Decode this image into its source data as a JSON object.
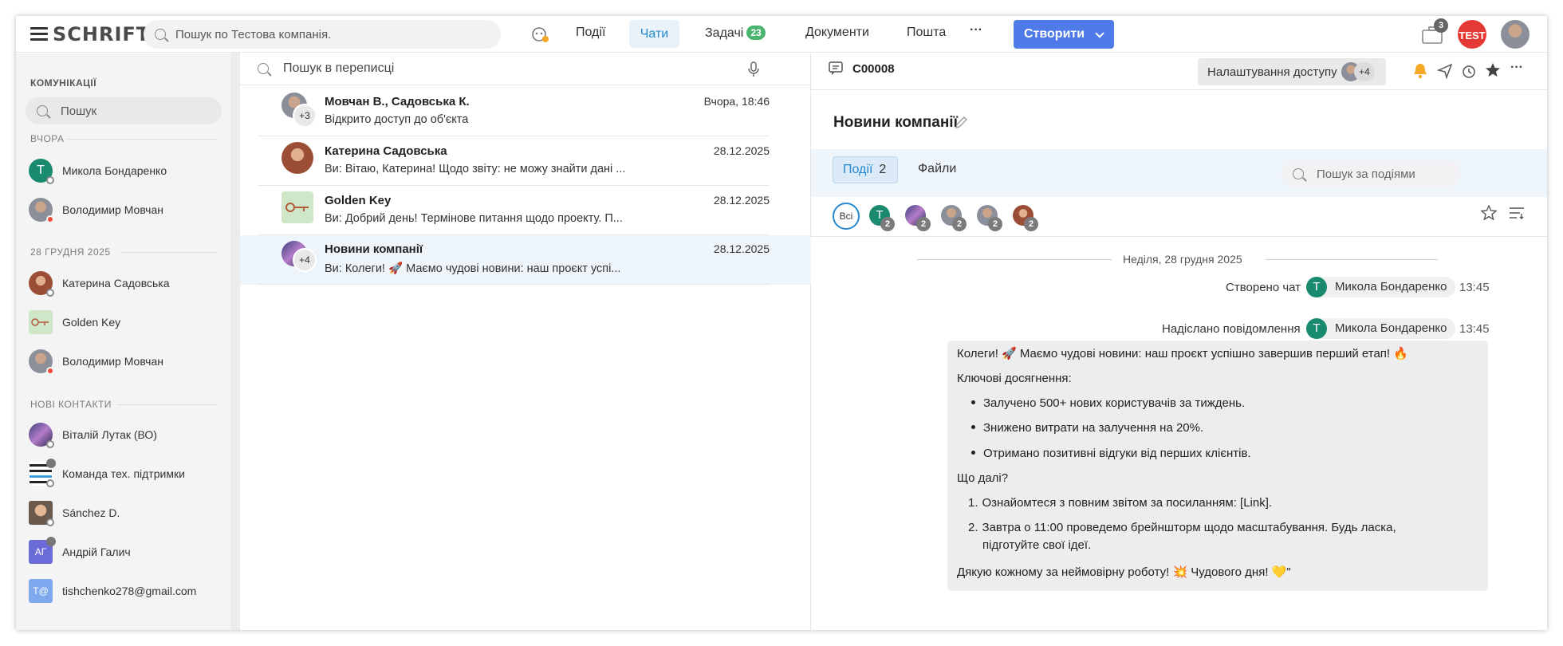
{
  "topbar": {
    "logo": "SCHRIFT",
    "search_placeholder": "Пошук по Тестова компанія.",
    "nav": {
      "events": "Події",
      "chats": "Чати",
      "tasks": "Задачі",
      "tasks_count": "23",
      "documents": "Документи",
      "mail": "Пошта",
      "more": "···"
    },
    "create_label": "Створити",
    "notifications_count": "3",
    "company_badge": "TEST"
  },
  "sidebar": {
    "title": "КОМУНІКАЦІЇ",
    "search_placeholder": "Пошук",
    "sections": {
      "yesterday": "ВЧОРА",
      "dec28": "28 ГРУДНЯ 2025",
      "new_contacts": "НОВІ КОНТАКТИ"
    },
    "items": [
      {
        "name": "Микола Бондаренко",
        "initial": "T"
      },
      {
        "name": "Володимир Мовчан"
      },
      {
        "name": "Катерина Садовська"
      },
      {
        "name": "Golden Key"
      },
      {
        "name": "Володимир Мовчан"
      },
      {
        "name": "Віталій Лутак (ВО)"
      },
      {
        "name": "Команда тех. підтримки"
      },
      {
        "name": "Sánchez D."
      },
      {
        "name": "Андрій Галич",
        "initial": "АГ"
      },
      {
        "name": "tishchenko278@gmail.com",
        "initial": "T@"
      }
    ]
  },
  "list": {
    "search_placeholder": "Пошук в переписці",
    "rows": [
      {
        "title": "Мовчан В., Садовська К.",
        "message": "Відкрито доступ до об'єкта",
        "date": "Вчора, 18:46",
        "more": "+3"
      },
      {
        "title": "Катерина Садовська",
        "message": "Ви: Вітаю, Катерина! Щодо звіту: не можу знайти дані ...",
        "date": "28.12.2025"
      },
      {
        "title": "Golden Key",
        "message": "Ви: Добрий день! Термінове питання щодо проекту. П...",
        "date": "28.12.2025"
      },
      {
        "title": "Новини компанії",
        "message": "Ви: Колеги! 🚀 Маємо чудові новини: наш проєкт успі...",
        "date": "28.12.2025",
        "more": "+4"
      }
    ]
  },
  "chat": {
    "code": "C00008",
    "access_button": "Налаштування доступу",
    "access_more": "+4",
    "title": "Новини компанії",
    "tabs": {
      "events": "Події",
      "events_count": "2",
      "files": "Файли"
    },
    "all_label": "Всі",
    "filter_t": "T",
    "filter_count": "2",
    "event_search_placeholder": "Пошук за подіями",
    "date_divider": "Неділя, 28 грудня 2025",
    "created": {
      "label": "Створено чат",
      "user": "Микола Бондаренко",
      "time": "13:45"
    },
    "sent": {
      "label": "Надіслано повідомлення",
      "user": "Микола Бондаренко",
      "time": "13:45"
    },
    "message": {
      "intro": "Колеги! 🚀 Маємо чудові новини: наш проєкт успішно завершив перший етап! 🔥",
      "achievements_title": "Ключові досягнення:",
      "bullets": [
        "Залучено 500+ нових користувачів за тиждень.",
        "Знижено витрати на залучення на 20%.",
        "Отримано позитивні відгуки від перших клієнтів."
      ],
      "next_title": "Що далі?",
      "steps": [
        "Ознайомтеся з повним звітом за посиланням: [Link].",
        "Завтра о 11:00 проведемо брейншторм щодо масштабування. Будь ласка,",
        "підготуйте свої ідеї."
      ],
      "outro": "Дякую кожному за неймовірну роботу! 💥 Чудового дня! 💛\""
    }
  }
}
